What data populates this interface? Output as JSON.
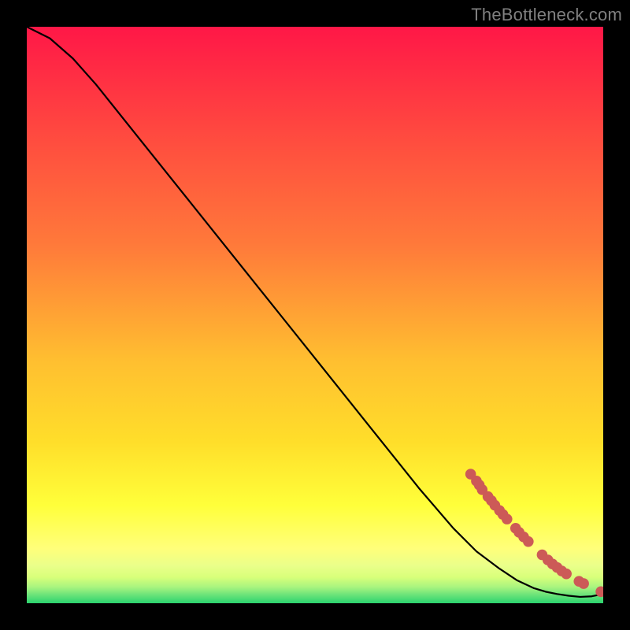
{
  "watermark": {
    "text": "TheBottleneck.com"
  },
  "chart_data": {
    "type": "line",
    "title": "",
    "xlabel": "",
    "ylabel": "",
    "xlim": [
      0,
      100
    ],
    "ylim": [
      0,
      100
    ],
    "grid": false,
    "legend": false,
    "background_gradient": {
      "top": "#ff1747",
      "mid1": "#ff7a3a",
      "mid2": "#ffde2a",
      "low": "#ffff7a",
      "band": "#d8ff7a",
      "bottom": "#2bd36e"
    },
    "series": [
      {
        "name": "curve",
        "type": "line",
        "x": [
          0,
          4,
          8,
          12,
          16,
          20,
          28,
          36,
          44,
          52,
          60,
          68,
          74,
          78,
          82,
          85,
          88,
          90,
          92,
          94,
          96,
          98,
          100
        ],
        "y": [
          100,
          98,
          94.5,
          90,
          85,
          80,
          70,
          60,
          50,
          40,
          30,
          20,
          13,
          9,
          6,
          4,
          2.6,
          2.0,
          1.6,
          1.3,
          1.1,
          1.2,
          1.6
        ]
      },
      {
        "name": "markers",
        "type": "scatter",
        "x": [
          77,
          78,
          78.5,
          79,
          80,
          80.6,
          81.2,
          82,
          82.6,
          83.3,
          84.8,
          85.4,
          86.2,
          87,
          89.4,
          90.4,
          91.2,
          92,
          92.8,
          93.6,
          95.8,
          96.6,
          99.6
        ],
        "y": [
          22.4,
          21.2,
          20.5,
          19.7,
          18.5,
          17.8,
          17.0,
          16.1,
          15.4,
          14.6,
          13.0,
          12.3,
          11.5,
          10.7,
          8.4,
          7.5,
          6.8,
          6.2,
          5.6,
          5.1,
          3.8,
          3.4,
          2.0
        ]
      }
    ]
  }
}
